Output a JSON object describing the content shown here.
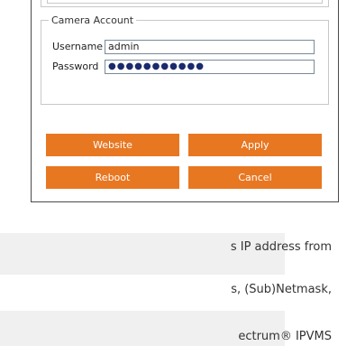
{
  "dialog": {
    "camera_account": {
      "legend": "Camera Account",
      "username_label": "Username",
      "username_value": "admin",
      "password_label": "Password",
      "password_value": "●●●●●●●●●●●"
    },
    "buttons": {
      "website": "Website",
      "apply": "Apply",
      "reboot": "Reboot",
      "cancel": "Cancel"
    }
  },
  "notes": {
    "line1": "s IP address from",
    "line2": "s, (Sub)Netmask,",
    "line3": "ectrum® IPVMS"
  },
  "colors": {
    "button_bg": "#e87722",
    "note_band": "#f0f0f0"
  }
}
